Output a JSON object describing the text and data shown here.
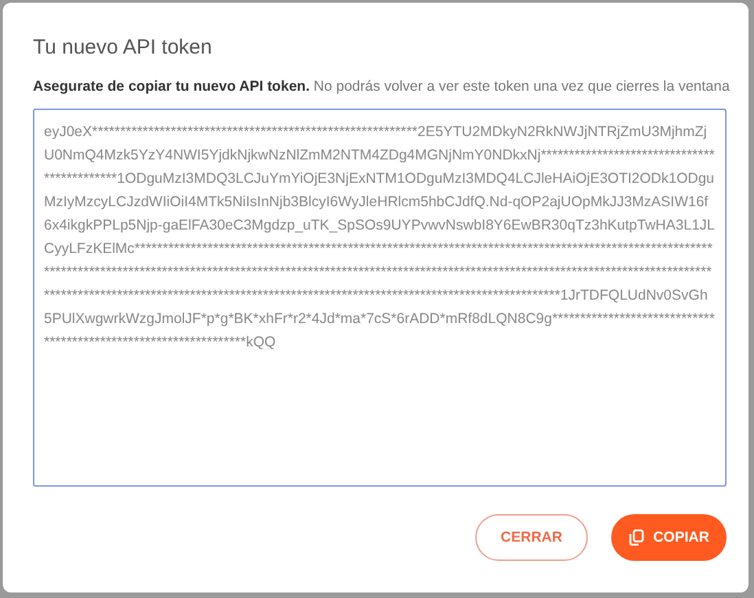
{
  "dialog": {
    "title": "Tu nuevo API token",
    "message": "**Asegurate de copiar tu nuevo API token.** No podrás volver a ver este token una vez que cierres la ventana",
    "token_field": {
      "value": "eyJ0eX**********************************************************2E5YTU2MDkyN2RkNWJjNTRjZmU3MjhmZjU0NmQ4Mzk5YzY4NWI5YjdkNjkwNzNlZmM2NTM4ZDg4MGNjNmY0NDkxNj********************************************1ODguMzI3MDQ3LCJuYmYiOjE3NjExNTM1ODguMzI3MDQ4LCJleHAiOjE3OTI2ODk1ODguMzIyMzcyLCJzdWIiOiI4MTk5NiIsInNjb3BlcyI6WyJleHRlcm5hbCJdfQ.Nd-qOP2ajUOpMkJJ3MzASIW16f6x4ikgkPPLp5Njp-gaElFA30eC3Mgdzp_uTK_SpSOs9UYPvwvNswbI8Y6EwBR30qTz3hKutpTwHA3L1JLCyyLFzKElMc**************************************************************************************************************************************************************************************************************************************************************************************************************************1JrTDFQLUdNv0SvGh5PUlXwgwrkWzgJmolJF*p*g*BK*xhFr*r2*4Jd*ma*7cS*6rADD*mRf8dLQN8C9g*****************************************************************kQQ"
    },
    "buttons": [
      {
        "kind": "secondary",
        "label": "CERRAR"
      },
      {
        "kind": "primary",
        "label": "COPIAR"
      }
    ]
  }
}
